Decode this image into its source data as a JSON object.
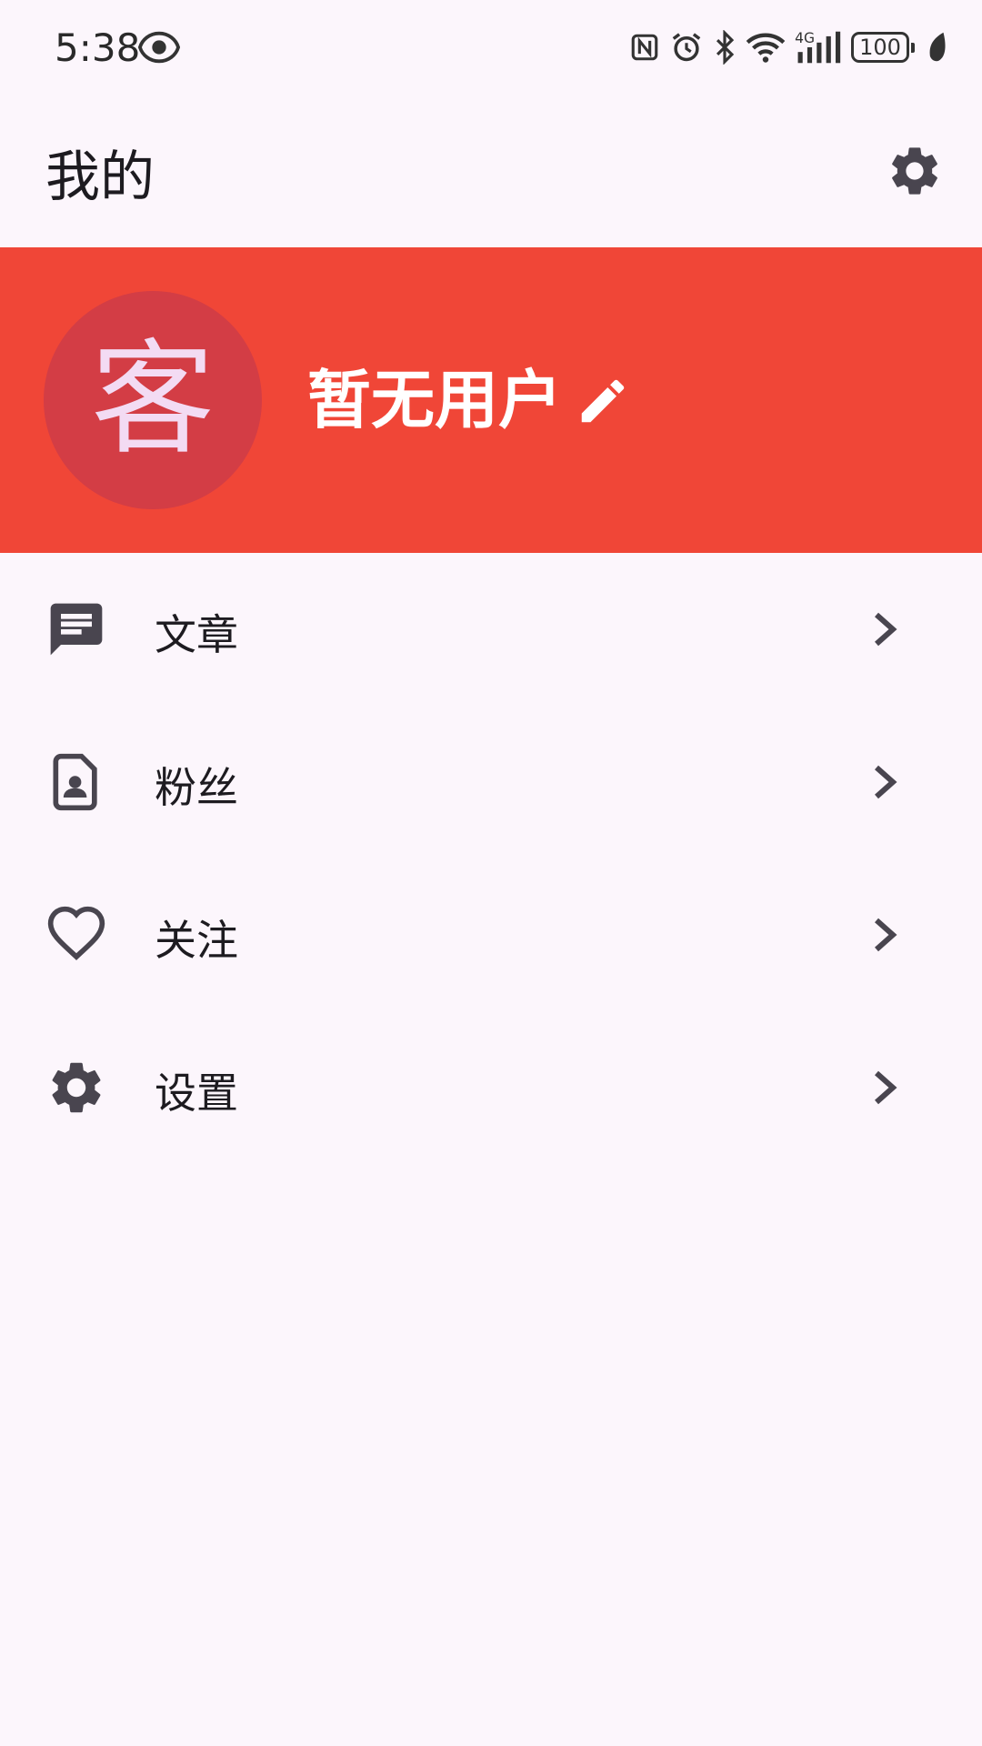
{
  "status_bar": {
    "time": "5:38",
    "battery": "100"
  },
  "app_bar": {
    "title": "我的"
  },
  "profile": {
    "avatar_char": "客",
    "username": "暂无用户",
    "banner_color": "#f04637",
    "avatar_color": "#d33d45"
  },
  "menu": {
    "items": [
      {
        "label": "文章",
        "icon": "article-icon"
      },
      {
        "label": "粉丝",
        "icon": "contact-card-icon"
      },
      {
        "label": "关注",
        "icon": "heart-icon"
      },
      {
        "label": "设置",
        "icon": "gear-icon"
      }
    ]
  }
}
